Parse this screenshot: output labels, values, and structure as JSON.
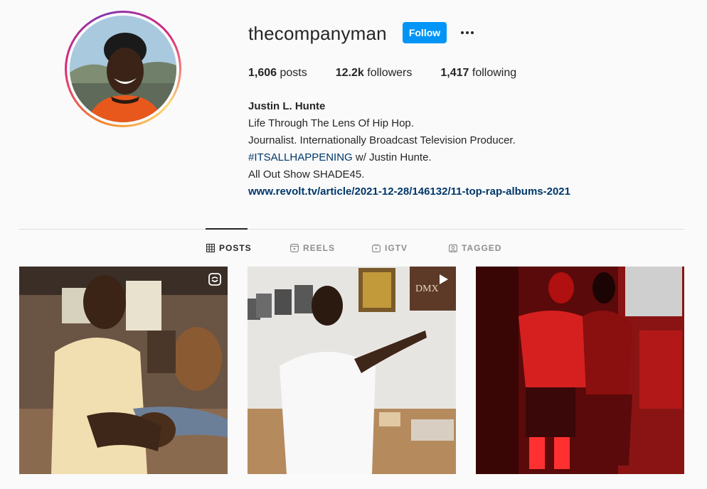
{
  "profile": {
    "username": "thecompanyman",
    "follow_label": "Follow",
    "stats": {
      "posts_value": "1,606",
      "posts_label": "posts",
      "followers_value": "12.2k",
      "followers_label": "followers",
      "following_value": "1,417",
      "following_label": "following"
    },
    "bio": {
      "full_name": "Justin L. Hunte",
      "line1": "Life Through The Lens Of Hip Hop.",
      "line2": "Journalist. Internationally Broadcast Television Producer.",
      "hashtag": "#ITSALLHAPPENING",
      "line3_rest": " w/ Justin Hunte.",
      "line4": "All Out Show SHADE45.",
      "website": "www.revolt.tv/article/2021-12-28/146132/11-top-rap-albums-2021"
    }
  },
  "tabs": [
    {
      "label": "POSTS",
      "icon": "grid-icon",
      "active": true
    },
    {
      "label": "REELS",
      "icon": "reels-icon",
      "active": false
    },
    {
      "label": "IGTV",
      "icon": "igtv-icon",
      "active": false
    },
    {
      "label": "TAGGED",
      "icon": "tagged-icon",
      "active": false
    }
  ],
  "posts": [
    {
      "badge_icon": "reels-badge-icon",
      "scene": "man in beige shirt reaching toward camera in bar"
    },
    {
      "badge_icon": "play-badge-icon",
      "scene": "man in white shirt pointing at framed albums"
    },
    {
      "badge_icon": "",
      "scene": "two people under red light"
    }
  ],
  "colors": {
    "follow_button": "#0095f6",
    "link": "#00376b",
    "text": "#262626",
    "muted": "#8e8e8e",
    "background": "#fafafa"
  }
}
